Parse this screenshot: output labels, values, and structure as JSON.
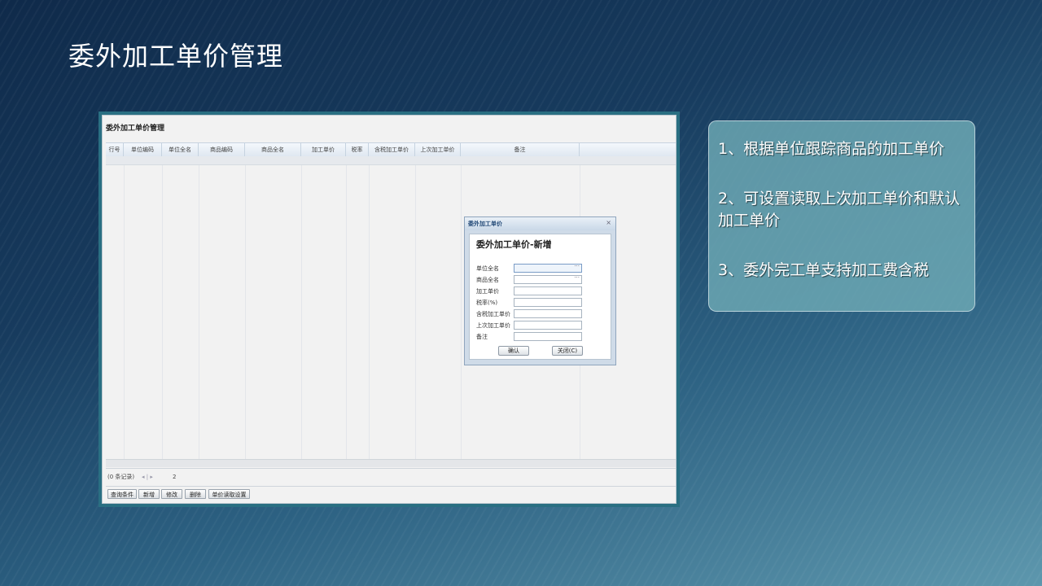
{
  "slide": {
    "title": "委外加工单价管理",
    "points": [
      "1、根据单位跟踪商品的加工单价",
      "2、可设置读取上次加工单价和默认加工单价",
      "3、委外完工单支持加工费含税"
    ]
  },
  "app": {
    "title": "委外加工单价管理",
    "columns": [
      "行号",
      "单位编码",
      "单位全名",
      "商品编码",
      "商品全名",
      "加工单价",
      "税率",
      "含税加工单价",
      "上次加工单价",
      "备注"
    ],
    "pager": {
      "record_count": "(0 条记录)",
      "nav": "◂ | ▸",
      "page": "2"
    },
    "toolbar": [
      "查询条件",
      "新增",
      "修改",
      "删除",
      "单价读取设置"
    ]
  },
  "dialog": {
    "title": "委外加工单价",
    "heading": "委外加工单价-新增",
    "close_icon": "×",
    "fields": [
      {
        "label": "单位全名",
        "value": "",
        "has_picker": true
      },
      {
        "label": "商品全名",
        "value": "",
        "has_picker": true
      },
      {
        "label": "加工单价",
        "value": ""
      },
      {
        "label": "税率(%)",
        "value": ""
      },
      {
        "label": "含税加工单价",
        "value": ""
      },
      {
        "label": "上次加工单价",
        "value": ""
      },
      {
        "label": "备注",
        "value": ""
      }
    ],
    "picker_icon": "···",
    "confirm_label": "确认",
    "close_label": "关闭(C)"
  }
}
